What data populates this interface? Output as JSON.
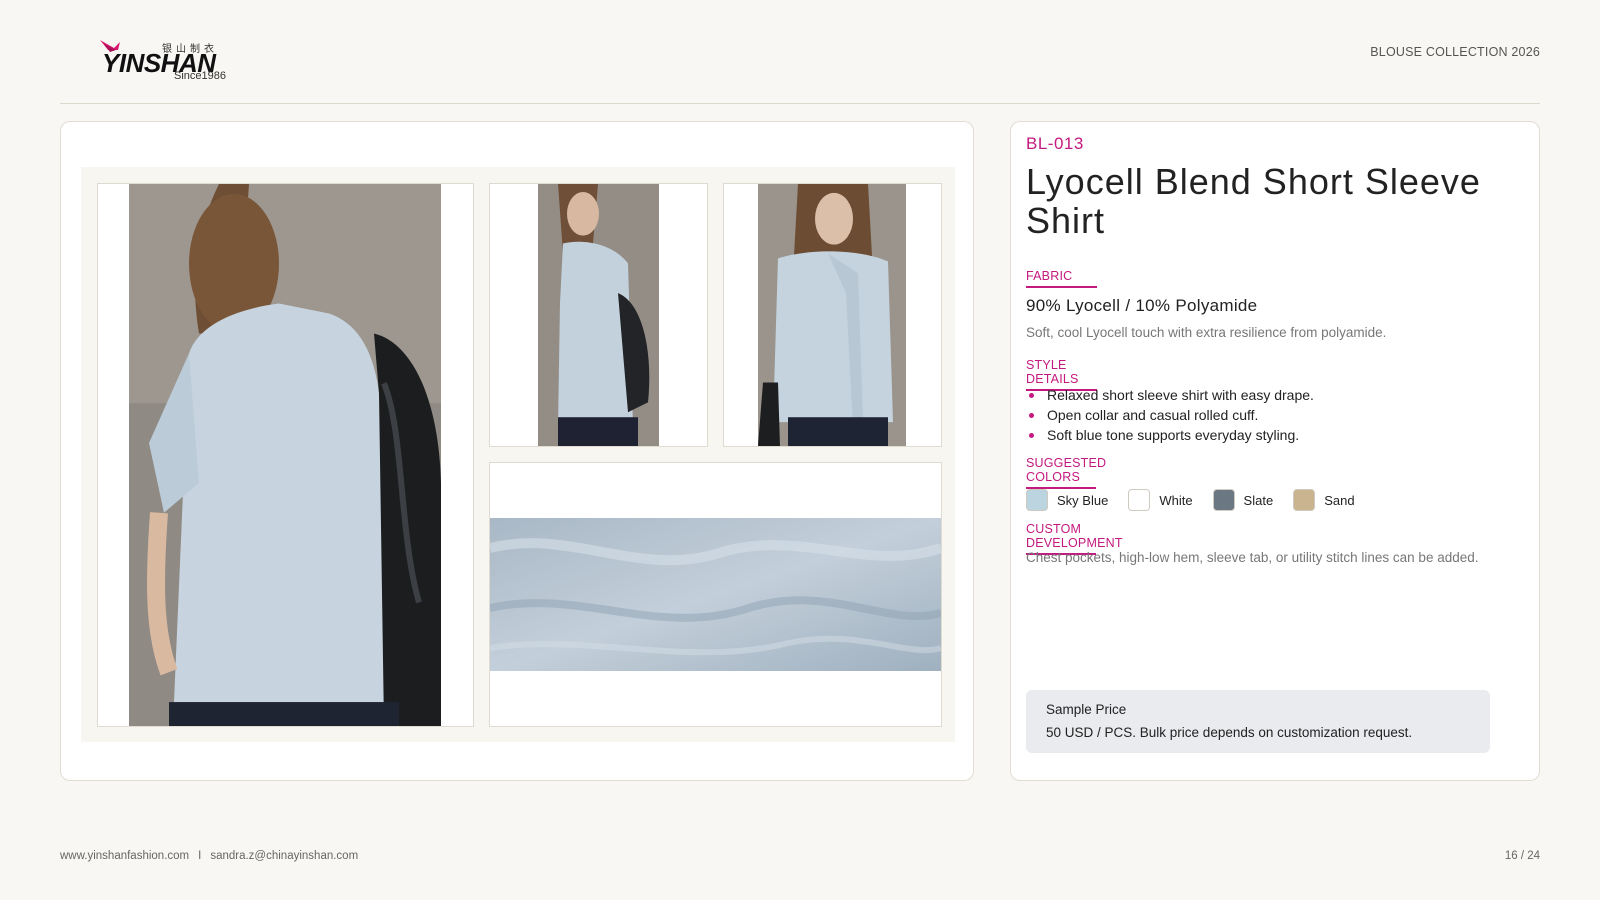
{
  "brand": {
    "chinese_name": "银山制衣",
    "name": "YINSHAN",
    "since": "Since1986"
  },
  "header": {
    "collection": "BLOUSE COLLECTION 2026"
  },
  "gallery": {
    "images": [
      {
        "name": "back-view-photo",
        "depicts": "model in light blue shirt, back view with black bag"
      },
      {
        "name": "side-view-photo",
        "depicts": "model in light blue shirt, side view"
      },
      {
        "name": "front-view-photo",
        "depicts": "model in light blue shirt, front view with scarf"
      },
      {
        "name": "fabric-closeup-photo",
        "depicts": "light blue crinkled fabric close-up"
      }
    ]
  },
  "product": {
    "code": "BL-013",
    "title": "Lyocell Blend Short Sleeve Shirt",
    "fabric": {
      "label": "FABRIC",
      "value": "90% Lyocell / 10% Polyamide",
      "description": "Soft, cool Lyocell touch with extra resilience from polyamide."
    },
    "style": {
      "label": "STYLE DETAILS",
      "items": [
        "Relaxed short sleeve shirt with easy drape.",
        "Open collar and casual rolled cuff.",
        "Soft blue tone supports everyday styling."
      ]
    },
    "colors": {
      "label": "SUGGESTED COLORS",
      "items": [
        {
          "name": "Sky Blue",
          "hex": "#bcd3e0"
        },
        {
          "name": "White",
          "hex": "#ffffff"
        },
        {
          "name": "Slate",
          "hex": "#6b7782"
        },
        {
          "name": "Sand",
          "hex": "#c9b48f"
        }
      ]
    },
    "custom": {
      "label": "CUSTOM DEVELOPMENT",
      "description": "Chest pockets, high-low hem, sleeve tab, or utility stitch lines can be added."
    },
    "price": {
      "label": "Sample Price",
      "text": "50 USD / PCS. Bulk price depends on customization request."
    }
  },
  "footer": {
    "website": "www.yinshanfashion.com",
    "separator": "I",
    "email": "sandra.z@chinayinshan.com",
    "page": "16 / 24"
  },
  "theme": {
    "accent": "#c4197e",
    "background": "#f8f7f3"
  }
}
